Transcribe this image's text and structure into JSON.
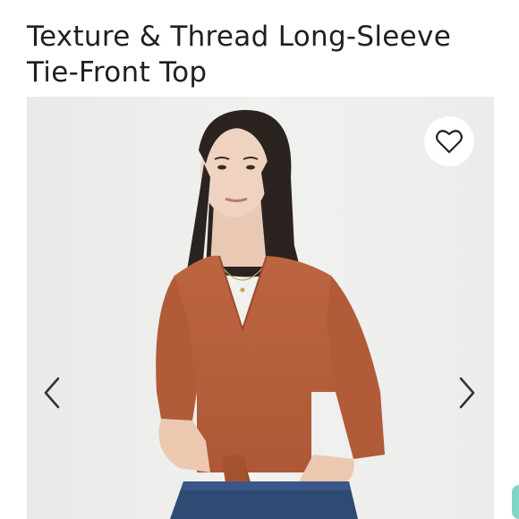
{
  "product": {
    "title_lines": [
      "Texture & Thread Long-Sleeve",
      "Tie-Front Top"
    ]
  },
  "gallery": {
    "favorite_icon": "heart-outline-icon",
    "prev_icon": "chevron-left-icon",
    "next_icon": "chevron-right-icon"
  },
  "colors": {
    "photo_background": "#efefed",
    "top_color": "#b75f3c",
    "jeans_color": "#2f4a73"
  }
}
